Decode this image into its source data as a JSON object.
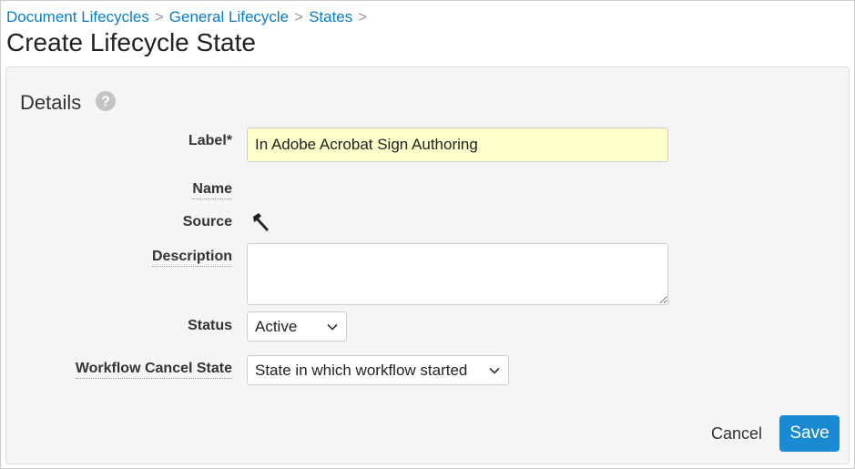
{
  "breadcrumb": [
    {
      "label": "Document Lifecycles"
    },
    {
      "label": "General Lifecycle"
    },
    {
      "label": "States"
    }
  ],
  "breadcrumb_sep": ">",
  "page_title": "Create Lifecycle State",
  "section": {
    "title": "Details",
    "help_icon": "question-circle-icon"
  },
  "fields": {
    "label": {
      "label": "Label*",
      "value": "In Adobe Acrobat Sign Authoring",
      "highlight_color": "#ffffcc"
    },
    "name": {
      "label": "Name",
      "value": ""
    },
    "source": {
      "label": "Source",
      "icon": "hammer-icon"
    },
    "description": {
      "label": "Description",
      "value": ""
    },
    "status": {
      "label": "Status",
      "value": "Active"
    },
    "workflow_cancel_state": {
      "label": "Workflow Cancel State",
      "value": "State in which workflow started"
    }
  },
  "actions": {
    "cancel": "Cancel",
    "save": "Save",
    "save_color": "#1a8ad3"
  },
  "colors": {
    "link": "#0a7cc4"
  }
}
